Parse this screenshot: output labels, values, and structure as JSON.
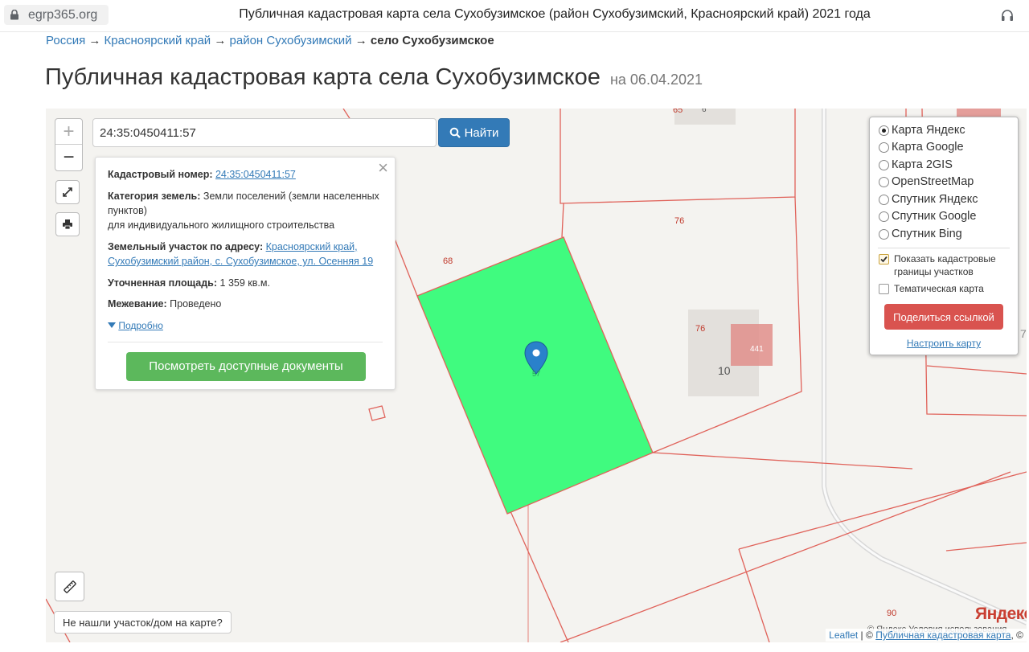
{
  "browser": {
    "url": "egrp365.org",
    "tab_title": "Публичная кадастровая карта села Сухобузимское (район Сухобузимский, Красноярский край) 2021 года"
  },
  "breadcrumb": {
    "items": [
      "Россия",
      "Красноярский край",
      "район Сухобузимский"
    ],
    "separator": "→",
    "current": "село Сухобузимское"
  },
  "page": {
    "title": "Публичная кадастровая карта села Сухобузимское",
    "date": "на 06.04.2021"
  },
  "search": {
    "value": "24:35:0450411:57",
    "button_label": "Найти"
  },
  "zoom": {
    "in": "+",
    "out": "−"
  },
  "popup": {
    "cadastral_label": "Кадастровый номер:",
    "cadastral_value": "24:35:0450411:57",
    "category_label": "Категория земель:",
    "category_value": "Земли поселений (земли населенных пунктов)",
    "usage": "для индивидуального жилищного строительства",
    "address_label": "Земельный участок по адресу:",
    "address_value": "Красноярский край, Сухобузимский район, с. Сухобузимское, ул. Осенняя 19",
    "area_label": "Уточненная площадь:",
    "area_value": "1 359 кв.м.",
    "survey_label": "Межевание:",
    "survey_value": "Проведено",
    "more_label": "Подробно",
    "docs_button": "Посмотреть доступные документы"
  },
  "layers": {
    "options": [
      {
        "label": "Карта Яндекс",
        "selected": true
      },
      {
        "label": "Карта Google",
        "selected": false
      },
      {
        "label": "Карта 2GIS",
        "selected": false
      },
      {
        "label": "OpenStreetMap",
        "selected": false
      },
      {
        "label": "Спутник Яндекс",
        "selected": false
      },
      {
        "label": "Спутник Google",
        "selected": false
      },
      {
        "label": "Спутник Bing",
        "selected": false
      }
    ],
    "show_borders_label": "Показать кадастровые границы участков",
    "show_borders_checked": true,
    "thematic_label": "Тематическая карта",
    "thematic_checked": false,
    "share_button": "Поделиться ссылкой",
    "configure_link": "Настроить карту"
  },
  "map": {
    "parcel_numbers": [
      "68",
      "76",
      "76",
      "10",
      "441",
      "65",
      "6",
      "90",
      "57",
      "7"
    ],
    "not_found_label": "Не нашли участок/дом на карте?",
    "yandex_logo": "Яндекс",
    "terms_text": "© Яндекс  Условия использования",
    "attribution": {
      "leaflet": "Leaflet",
      "sep": "|",
      "copyright": "©",
      "link": "Публичная кадастровая карта",
      "tail": ", ©"
    }
  },
  "colors": {
    "parcel_fill": "#40fb7f",
    "border": "#e0625a",
    "link": "#337ab7",
    "search_button": "#337ab7",
    "docs_button": "#5cb85c",
    "share_button": "#d9534f",
    "marker": "#2a81cb"
  }
}
